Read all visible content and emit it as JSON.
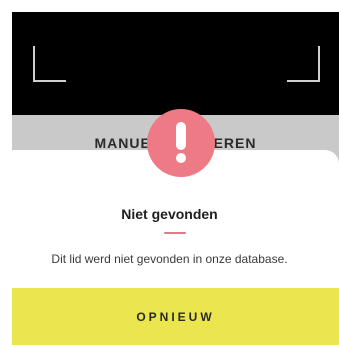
{
  "camera": {
    "manual_label": "MANUEEL INVOEREN"
  },
  "dialog": {
    "icon": "exclamation-icon",
    "title": "Niet gevonden",
    "message": "Dit lid werd niet gevonden in onze database.",
    "retry_label": "OPNIEUW",
    "colors": {
      "alert": "#ee7a85",
      "button": "#ebe54e",
      "underline": "#e07a85"
    }
  }
}
